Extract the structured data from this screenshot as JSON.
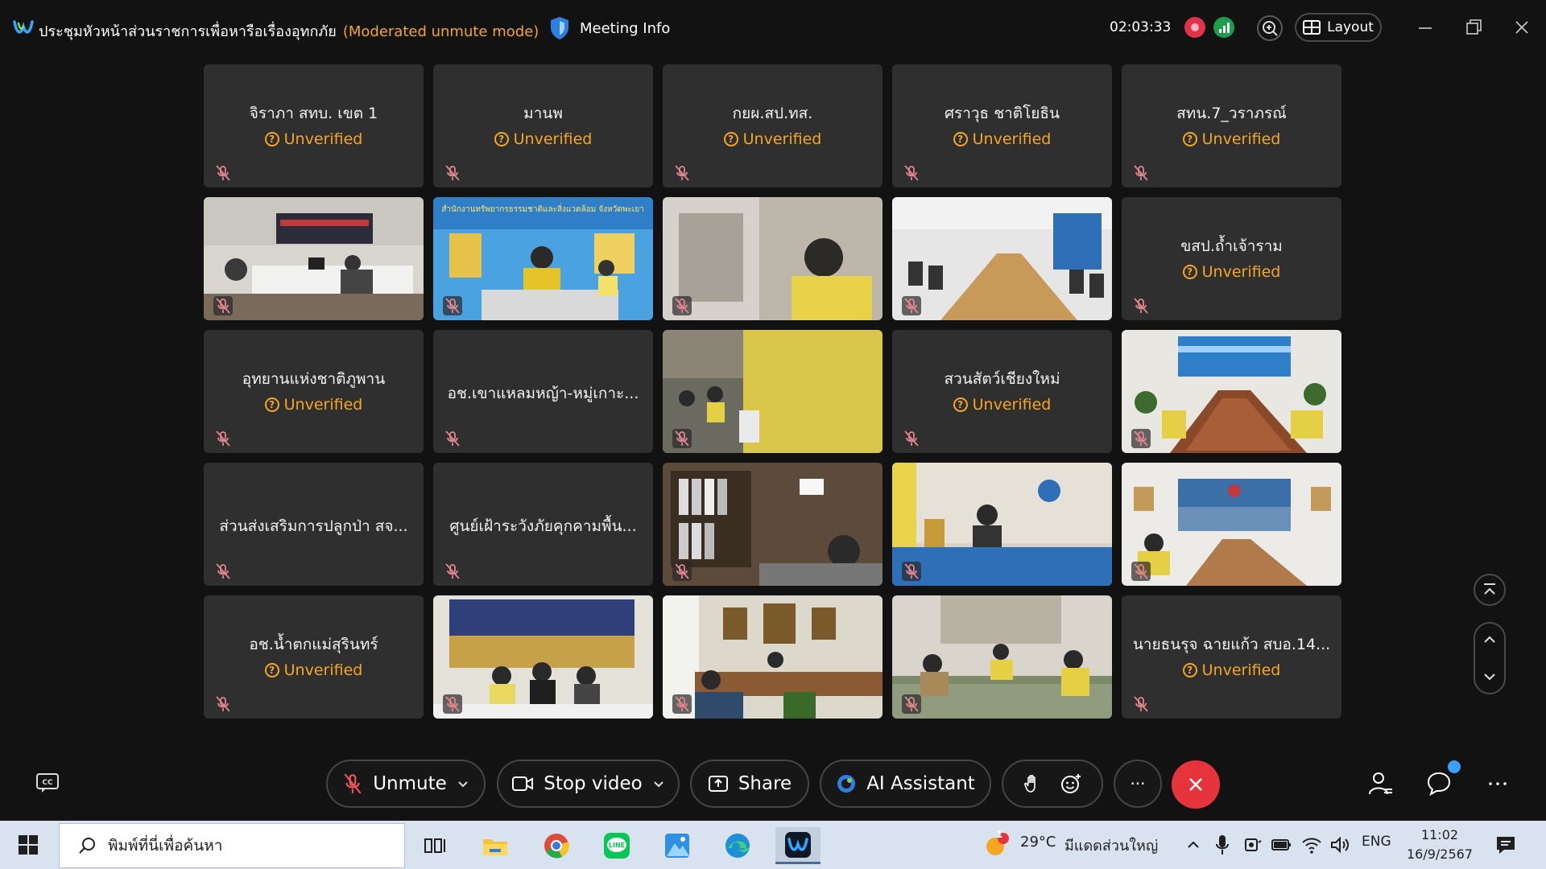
{
  "titlebar": {
    "meeting_title": "ประชุมหัวหน้าส่วนราชการเพื่อหารือเรื่องอุทกภัย",
    "mode": "(Moderated unmute mode)",
    "meeting_info": "Meeting Info",
    "timer": "02:03:33",
    "layout_label": "Layout"
  },
  "participants": [
    {
      "name": "จิราภา สทบ. เขต 1",
      "status": "Unverified"
    },
    {
      "name": "มานพ",
      "status": "Unverified"
    },
    {
      "name": "กยผ.สป.ทส.",
      "status": "Unverified"
    },
    {
      "name": "ศราวุธ ชาติโยธิน",
      "status": "Unverified"
    },
    {
      "name": "สทน.7_วราภรณ์",
      "status": "Unverified"
    },
    {
      "name": "ขสป.ถ้ำเจ้าราม",
      "status": "Unverified"
    },
    {
      "name": "อุทยานแห่งชาติภูพาน",
      "status": "Unverified"
    },
    {
      "name": "อช.เขาแหลมหญ้า-หมู่เกาะ..."
    },
    {
      "name": "สวนสัตว์เชียงใหม่",
      "status": "Unverified"
    },
    {
      "name": "ส่วนส่งเสริมการปลูกป่า สจ..."
    },
    {
      "name": "ศูนย์เฝ้าระวังภัยคุกคามพื้น..."
    },
    {
      "name": "อช.น้ำตกแม่สุรินทร์",
      "status": "Unverified"
    },
    {
      "name": "นายธนรุจ ฉายแก้ว สบอ.14...",
      "status": "Unverified"
    }
  ],
  "video_banners": {
    "v2": "สำนักงานทรัพยากรธรรมชาติและสิ่งแวดล้อม จังหวัดพะเยา"
  },
  "controls": {
    "unmute": "Unmute",
    "stop_video": "Stop video",
    "share": "Share",
    "ai_assistant": "AI Assistant",
    "more": "···"
  },
  "taskbar": {
    "search_placeholder": "พิมพ์ที่นี่เพื่อค้นหา",
    "weather_badge": "1",
    "weather_temp": "29°C",
    "weather_text": "มีแดดส่วนใหญ่",
    "language": "ENG",
    "time": "11:02",
    "date": "16/9/2567"
  },
  "colors": {
    "accent_unverified": "#f5a623",
    "end_call": "#e5343c",
    "tile_bg": "#2f2f2f"
  }
}
